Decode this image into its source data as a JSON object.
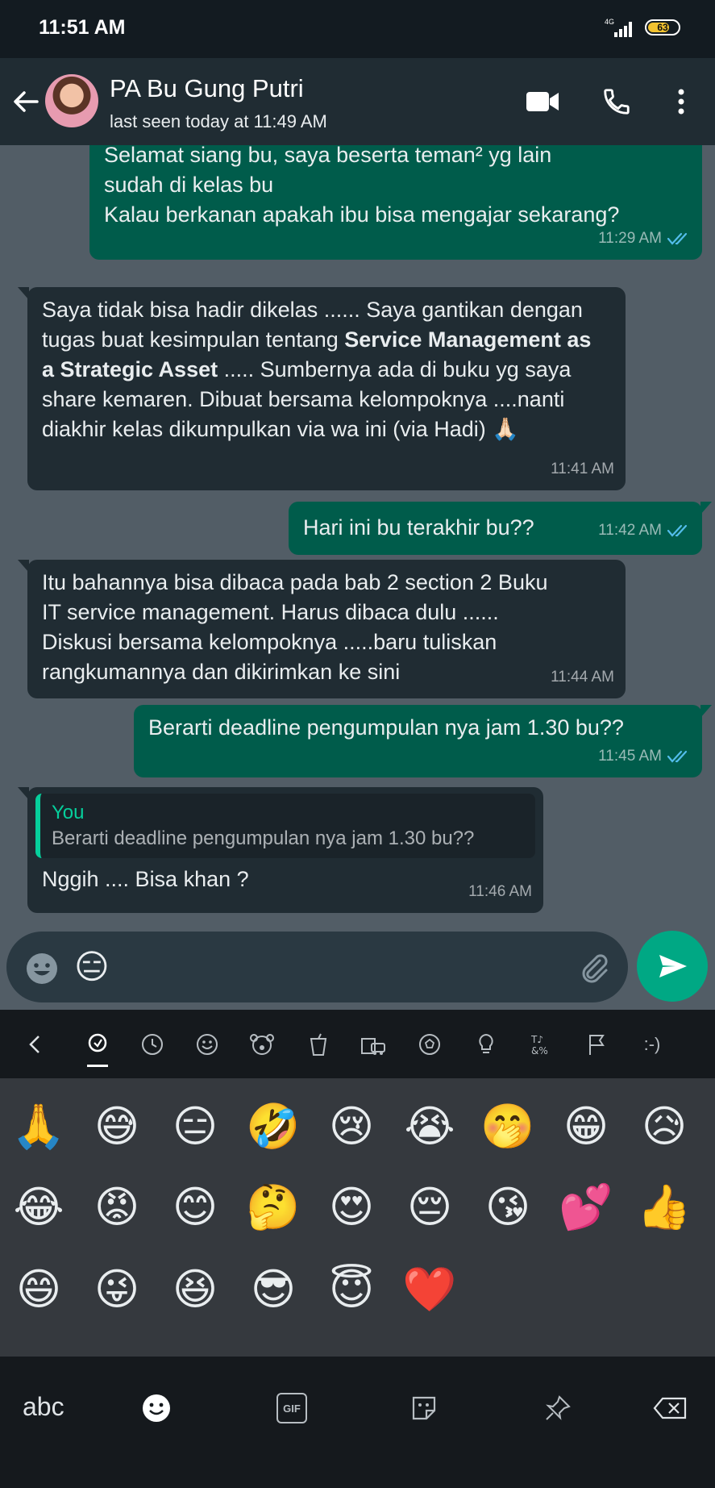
{
  "status_bar": {
    "time": "11:51 AM",
    "network": "4G",
    "battery": "63"
  },
  "header": {
    "contact_name": "PA Bu Gung Putri",
    "last_seen": "last seen today at 11:49 AM"
  },
  "messages": [
    {
      "dir": "out",
      "lines": [
        "Selamat siang bu, saya beserta teman² yg lain",
        "sudah di kelas bu",
        "Kalau berkanan apakah ibu bisa mengajar sekarang?"
      ],
      "time": "11:29 AM",
      "read": true
    },
    {
      "dir": "in",
      "parts": [
        "Saya tidak bisa hadir dikelas ...... Saya gantikan dengan tugas buat kesimpulan tentang ",
        "Service Management as a Strategic Asset",
        " ..... Sumbernya ada di buku yg saya share kemaren. Dibuat bersama kelompoknya ....nanti diakhir kelas dikumpulkan via wa ini (via Hadi) 🙏🏻"
      ],
      "time": "11:41 AM"
    },
    {
      "dir": "out",
      "text": "Hari ini bu terakhir bu??",
      "time": "11:42 AM",
      "read": true
    },
    {
      "dir": "in",
      "lines": [
        "Itu bahannya bisa dibaca pada bab 2 section 2 Buku",
        "IT service management. Harus dibaca dulu ......",
        "Diskusi bersama kelompoknya .....baru tuliskan",
        "rangkumannya dan dikirimkan ke sini"
      ],
      "time": "11:44 AM"
    },
    {
      "dir": "out",
      "text": "Berarti deadline pengumpulan nya jam 1.30 bu??",
      "time": "11:45 AM",
      "read": true
    },
    {
      "dir": "in",
      "quote": {
        "author": "You",
        "text": "Berarti deadline pengumpulan nya jam 1.30 bu??"
      },
      "text": "Nggih .... Bisa khan ?",
      "time": "11:46 AM"
    }
  ],
  "composer": {
    "draft_emoji": "😑"
  },
  "emoji_tabs": [
    "recent",
    "clock",
    "smileys",
    "animals",
    "food",
    "travel",
    "activities",
    "objects",
    "symbols",
    "flags",
    "emoticons"
  ],
  "emoticon_tab_label": ":-)",
  "emojis": [
    [
      "🙏",
      "😅",
      "😑",
      "🤣",
      "😢",
      "😭",
      "🤭",
      "😁",
      "😥"
    ],
    [
      "😂",
      "😡",
      "😊",
      "🤔",
      "😍",
      "😔",
      "😘",
      "💕",
      "👍"
    ],
    [
      "😄",
      "😜",
      "😆",
      "😎",
      "😇",
      "❤️"
    ]
  ],
  "keyboard": {
    "abc_label": "abc",
    "gif_label": "GIF"
  },
  "colors": {
    "accent": "#00a884",
    "outgoing": "#005c4b",
    "incoming": "#202c33",
    "read_tick": "#53bdeb"
  }
}
